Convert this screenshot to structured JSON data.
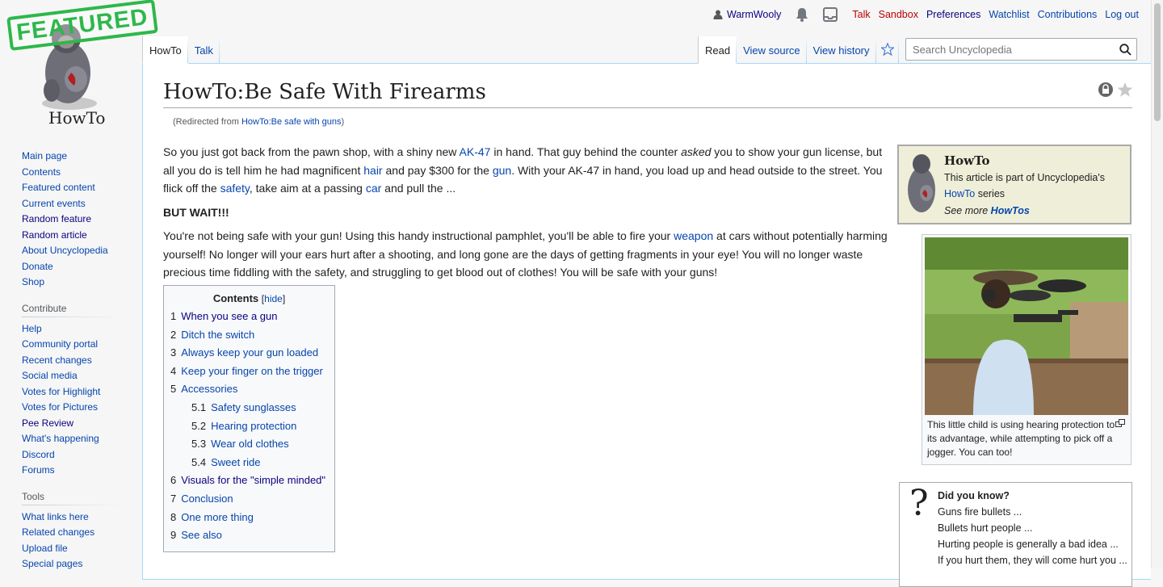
{
  "logo": {
    "stamp": "FEATURED",
    "caption": "HowTo"
  },
  "personal": {
    "username": "WarmWooly",
    "talk": "Talk",
    "sandbox": "Sandbox",
    "preferences": "Preferences",
    "watchlist": "Watchlist",
    "contributions": "Contributions",
    "logout": "Log out"
  },
  "tabs": {
    "namespace": "HowTo",
    "talk": "Talk",
    "read": "Read",
    "view_source": "View source",
    "view_history": "View history"
  },
  "search": {
    "placeholder": "Search Uncyclopedia"
  },
  "sidebar": {
    "navigation": [
      "Main page",
      "Contents",
      "Featured content",
      "Current events",
      "Random feature",
      "Random article",
      "About Uncyclopedia",
      "Donate",
      "Shop"
    ],
    "contribute_heading": "Contribute",
    "contribute": [
      "Help",
      "Community portal",
      "Recent changes",
      "Social media",
      "Votes for Highlight",
      "Votes for Pictures",
      "Pee Review",
      "What's happening",
      "Discord",
      "Forums"
    ],
    "tools_heading": "Tools",
    "tools": [
      "What links here",
      "Related changes",
      "Upload file",
      "Special pages"
    ]
  },
  "article": {
    "title": "HowTo:Be Safe With Firearms",
    "redirect_prefix": "(Redirected from ",
    "redirect_link": "HowTo:Be safe with guns",
    "redirect_suffix": ")",
    "p1": {
      "t1": "So you just got back from the pawn shop, with a shiny new ",
      "l1": "AK-47",
      "t2": " in hand. That guy behind the counter ",
      "em": "asked",
      "t3": " you to show your gun license, but all you do is tell him he had magnificent ",
      "l2": "hair",
      "t4": " and pay $300 for the ",
      "l3": "gun",
      "t5": ". With your AK-47 in hand, you load up and head outside to the street. You flick off the ",
      "l4": "safety",
      "t6": ", take aim at a passing ",
      "l5": "car",
      "t7": " and pull the ..."
    },
    "but_wait": "BUT WAIT!!!",
    "p2": {
      "t1": "You're not being safe with your gun! Using this handy instructional pamphlet, you'll be able to fire your ",
      "l1": "weapon",
      "t2": " at cars without potentially harming yourself! No longer will your ears hurt after a shooting, and long gone are the days of getting fragments in your eye! You will no longer waste precious time fiddling with the safety, and struggling to get blood out of clothes! You will be safe with your guns!"
    }
  },
  "toc": {
    "title": "Contents",
    "hide_open": "[",
    "hide": "hide",
    "hide_close": "]",
    "items": [
      {
        "num": "1",
        "label": "When you see a gun"
      },
      {
        "num": "2",
        "label": "Ditch the switch"
      },
      {
        "num": "3",
        "label": "Always keep your gun loaded"
      },
      {
        "num": "4",
        "label": "Keep your finger on the trigger"
      },
      {
        "num": "5",
        "label": "Accessories"
      },
      {
        "num": "5.1",
        "label": "Safety sunglasses"
      },
      {
        "num": "5.2",
        "label": "Hearing protection"
      },
      {
        "num": "5.3",
        "label": "Wear old clothes"
      },
      {
        "num": "5.4",
        "label": "Sweet ride"
      },
      {
        "num": "6",
        "label": "Visuals for the \"simple minded\""
      },
      {
        "num": "7",
        "label": "Conclusion"
      },
      {
        "num": "8",
        "label": "One more thing"
      },
      {
        "num": "9",
        "label": "See also"
      }
    ]
  },
  "howto_box": {
    "heading": "HowTo",
    "line1": "This article is part of Uncyclopedia's",
    "link": "HowTo",
    "line2_suffix": " series",
    "see_more": "See more ",
    "see_more_link": "HowTos"
  },
  "thumb": {
    "caption": "This little child is using hearing protection to its advantage, while attempting to pick off a jogger. You can too!"
  },
  "dyk": {
    "heading": "Did you know?",
    "lines": [
      "Guns fire bullets ...",
      "Bullets hurt people ...",
      "Hurting people is generally a bad idea ...",
      "If you hurt them, they will come hurt you ..."
    ]
  },
  "colors": {
    "link": "#0645ad",
    "visited": "#0b0080",
    "redlink": "#ba0000",
    "stamp": "#2db84a",
    "tabborder": "#a7d7f9"
  }
}
